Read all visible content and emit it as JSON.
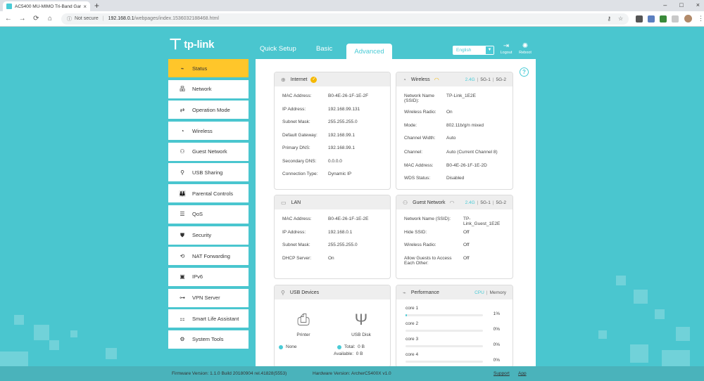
{
  "browser": {
    "tab_title": "AC5400 MU-MIMO Tri-Band Gar",
    "tab_close": "×",
    "new_tab": "+",
    "not_secure": "Not secure",
    "separator": "|",
    "url_host": "192.168.0.1",
    "url_path": "/webpages/index.1536032188468.html",
    "window_controls": [
      "–",
      "□",
      "×"
    ]
  },
  "header": {
    "logo_text": "tp-link",
    "tabs": [
      {
        "label": "Quick Setup"
      },
      {
        "label": "Basic"
      },
      {
        "label": "Advanced"
      }
    ],
    "language": "English",
    "logout_label": "Logout",
    "reboot_label": "Reboot",
    "help": "?"
  },
  "sidebar": {
    "items": [
      {
        "label": "Status",
        "icon": "pulse-icon",
        "active": true
      },
      {
        "label": "Network",
        "icon": "network-icon"
      },
      {
        "label": "Operation Mode",
        "icon": "operation-mode-icon"
      },
      {
        "label": "Wireless",
        "icon": "wireless-icon"
      },
      {
        "label": "Guest Network",
        "icon": "guest-network-icon"
      },
      {
        "label": "USB Sharing",
        "icon": "usb-icon"
      },
      {
        "label": "Parental Controls",
        "icon": "parental-controls-icon"
      },
      {
        "label": "QoS",
        "icon": "qos-icon"
      },
      {
        "label": "Security",
        "icon": "shield-icon"
      },
      {
        "label": "NAT Forwarding",
        "icon": "nat-forwarding-icon"
      },
      {
        "label": "IPv6",
        "icon": "ipv6-icon"
      },
      {
        "label": "VPN Server",
        "icon": "vpn-icon"
      },
      {
        "label": "Smart Life Assistant",
        "icon": "smart-life-icon"
      },
      {
        "label": "System Tools",
        "icon": "tools-icon"
      }
    ]
  },
  "internet": {
    "title": "Internet",
    "rows": [
      {
        "k": "MAC Address:",
        "v": "B0-4E-26-1F-1E-2F"
      },
      {
        "k": "IP Address:",
        "v": "192.168.99.131"
      },
      {
        "k": "Subnet Mask:",
        "v": "255.255.255.0"
      },
      {
        "k": "Default Gateway:",
        "v": "192.168.99.1"
      },
      {
        "k": "Primary DNS:",
        "v": "192.168.99.1"
      },
      {
        "k": "Secondary DNS:",
        "v": "0.0.0.0"
      },
      {
        "k": "Connection Type:",
        "v": "Dynamic IP"
      }
    ]
  },
  "wireless": {
    "title": "Wireless",
    "bands": [
      "2.4G",
      "5G-1",
      "5G-2"
    ],
    "rows": [
      {
        "k": "Network Name (SSID):",
        "v": "TP-Link_1E2E"
      },
      {
        "k": "Wireless Radio:",
        "v": "On"
      },
      {
        "k": "Mode:",
        "v": "802.11b/g/n mixed"
      },
      {
        "k": "Channel Width:",
        "v": "Auto"
      },
      {
        "k": "Channel:",
        "v": "Auto (Current Channel 8)"
      },
      {
        "k": "MAC Address:",
        "v": "B0-4E-26-1F-1E-2D"
      },
      {
        "k": "WDS Status:",
        "v": "Disabled"
      }
    ]
  },
  "lan": {
    "title": "LAN",
    "rows": [
      {
        "k": "MAC Address:",
        "v": "B0-4E-26-1F-1E-2E"
      },
      {
        "k": "IP Address:",
        "v": "192.168.0.1"
      },
      {
        "k": "Subnet Mask:",
        "v": "255.255.255.0"
      },
      {
        "k": "DHCP Server:",
        "v": "On"
      }
    ]
  },
  "guest": {
    "title": "Guest Network",
    "bands": [
      "2.4G",
      "5G-1",
      "5G-2"
    ],
    "rows": [
      {
        "k": "Network Name (SSID):",
        "v": "TP-Link_Guest_1E2E"
      },
      {
        "k": "Hide SSID:",
        "v": "Off"
      },
      {
        "k": "Wireless Radio:",
        "v": "Off"
      },
      {
        "k": "Allow Guests to Access Each Other:",
        "v": "Off"
      }
    ]
  },
  "usb": {
    "title": "USB Devices",
    "printer_label": "Printer",
    "disk_label": "USB Disk",
    "printer_status": "None",
    "total_label": "Total:",
    "total_value": "0 B",
    "available_label": "Available:",
    "available_value": "0 B"
  },
  "performance": {
    "title": "Performance",
    "toggle": [
      "CPU",
      "Memory"
    ],
    "cores": [
      {
        "name": "core 1",
        "percent": 1,
        "label": "1%"
      },
      {
        "name": "core 2",
        "percent": 0,
        "label": "0%"
      },
      {
        "name": "core 3",
        "percent": 0,
        "label": "0%"
      },
      {
        "name": "core 4",
        "percent": 0,
        "label": "0%"
      }
    ]
  },
  "footer": {
    "firmware": "Firmware Version: 1.1.0 Build 20180904 rel.41828(5553)",
    "hardware": "Hardware Version: ArcherC5400X v1.0",
    "support": "Support",
    "app": "App"
  },
  "colors": {
    "accent": "#4acbd6",
    "active_menu": "#ffc62a",
    "background": "#4ac6cf"
  }
}
